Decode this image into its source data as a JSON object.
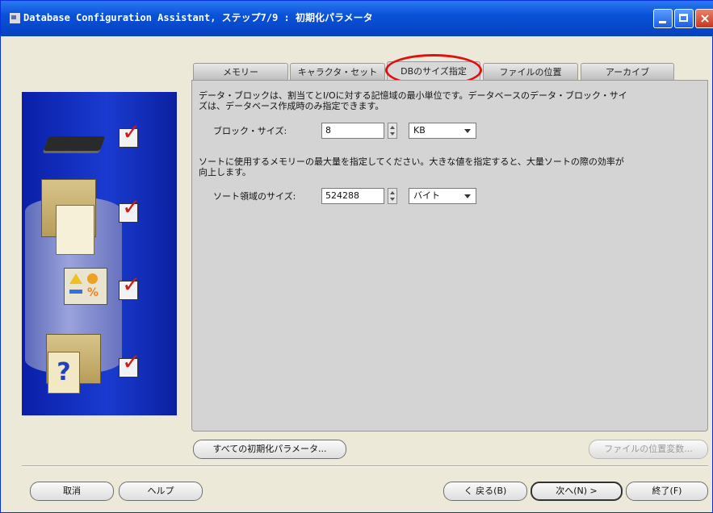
{
  "window": {
    "title": "Database Configuration Assistant, ステップ7/9 : 初期化パラメータ",
    "close_glyph": "×"
  },
  "tabs": [
    {
      "label": "メモリー"
    },
    {
      "label": "キャラクタ・セット"
    },
    {
      "label": "DBのサイズ指定",
      "active": true
    },
    {
      "label": "ファイルの位置"
    },
    {
      "label": "アーカイブ"
    }
  ],
  "highlight_color": "#e01010",
  "panel": {
    "block_desc": [
      "データ・ブロックは、割当てとI/Oに対する記憶域の最小単位です。データベースのデータ・ブロック・サイ",
      "ズは、データベース作成時のみ指定できます。"
    ],
    "block_size_label": "ブロック・サイズ:",
    "block_size_value": "8",
    "block_size_unit": "KB",
    "sort_desc": [
      "ソートに使用するメモリーの最大量を指定してください。大きな値を指定すると、大量ソートの際の効率が",
      "向上します。"
    ],
    "sort_area_label": "ソート領域のサイズ:",
    "sort_area_value": "524288",
    "sort_area_unit": "バイト"
  },
  "side_graphic": {
    "icons": [
      "memory-chip-icon",
      "documents-icon",
      "shapes-icon",
      "help-folder-icon"
    ],
    "check_glyph": "✓",
    "question_glyph": "?"
  },
  "buttons": {
    "all_params": "すべての初期化パラメータ...",
    "file_locations": "ファイルの位置変数...",
    "cancel": "取消",
    "help": "ヘルプ",
    "back": "く 戻る(B)",
    "next": "次へ(N) >",
    "finish": "終了(F)"
  }
}
